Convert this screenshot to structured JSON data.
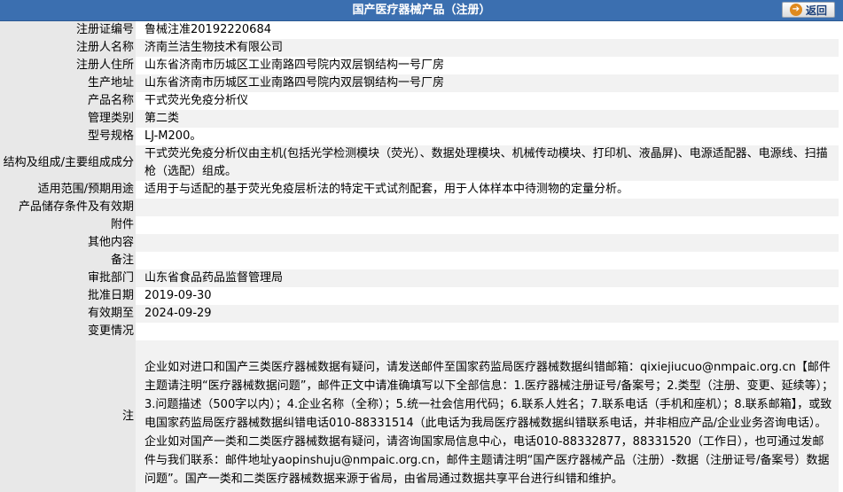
{
  "header": {
    "title": "国产医疗器械产品（注册）",
    "back_label": "返回"
  },
  "rows": [
    {
      "label": "注册证编号",
      "value": "鲁械注准20192220684"
    },
    {
      "label": "注册人名称",
      "value": "济南兰洁生物技术有限公司"
    },
    {
      "label": "注册人住所",
      "value": "山东省济南市历城区工业南路四号院内双层钢结构一号厂房"
    },
    {
      "label": "生产地址",
      "value": "山东省济南市历城区工业南路四号院内双层钢结构一号厂房"
    },
    {
      "label": "产品名称",
      "value": "干式荧光免疫分析仪"
    },
    {
      "label": "管理类别",
      "value": "第二类"
    },
    {
      "label": "型号规格",
      "value": "LJ-M200。"
    },
    {
      "label": "结构及组成/主要组成成分",
      "value": "干式荧光免疫分析仪由主机(包括光学检测模块（荧光）、数据处理模块、机械传动模块、打印机、液晶屏)、电源适配器、电源线、扫描枪（选配）组成。"
    },
    {
      "label": "适用范围/预期用途",
      "value": "适用于与适配的基于荧光免疫层析法的特定干式试剂配套，用于人体样本中待测物的定量分析。"
    },
    {
      "label": "产品储存条件及有效期",
      "value": ""
    },
    {
      "label": "附件",
      "value": ""
    },
    {
      "label": "其他内容",
      "value": ""
    },
    {
      "label": "备注",
      "value": ""
    },
    {
      "label": "审批部门",
      "value": "山东省食品药品监督管理局"
    },
    {
      "label": "批准日期",
      "value": "2019-09-30"
    },
    {
      "label": "有效期至",
      "value": "2024-09-29"
    },
    {
      "label": "变更情况",
      "value": ""
    }
  ],
  "note": {
    "label": "注",
    "text": "企业如对进口和国产三类医疗器械数据有疑问，请发送邮件至国家药监局医疗器械数据纠错邮箱：qixiejiucuo@nmpaic.org.cn【邮件主题请注明“医疗器械数据问题”，邮件正文中请准确填写以下全部信息：1.医疗器械注册证号/备案号；2.类型（注册、变更、延续等）；3.问题描述（500字以内）；4.企业名称（全称）；5.统一社会信用代码；6.联系人姓名；7.联系电话（手机和座机）；8.联系邮箱】，或致电国家药监局医疗器械数据纠错电话010-88331514（此电话为我局医疗器械数据纠错联系电话，并非相应产品/企业业务咨询电话）。企业如对国产一类和二类医疗器械数据有疑问，请咨询国家局信息中心，电话010-88332877，88331520（工作日），也可通过发邮件与我们联系：邮件地址yaopinshuju@nmpaic.org.cn，邮件主题请注明“国产医疗器械产品（注册）-数据（注册证号/备案号）数据问题”。国产一类和二类医疗器械数据来源于省局，由省局通过数据共享平台进行纠错和维护。"
  },
  "colors": {
    "header_bg": "#3b6fb0",
    "label_bg": "#e8e8e8",
    "alt_row_bg": "#f2f2f2",
    "back_icon": "#e08a1e"
  },
  "icons": {
    "back": "arrow-right-icon"
  }
}
